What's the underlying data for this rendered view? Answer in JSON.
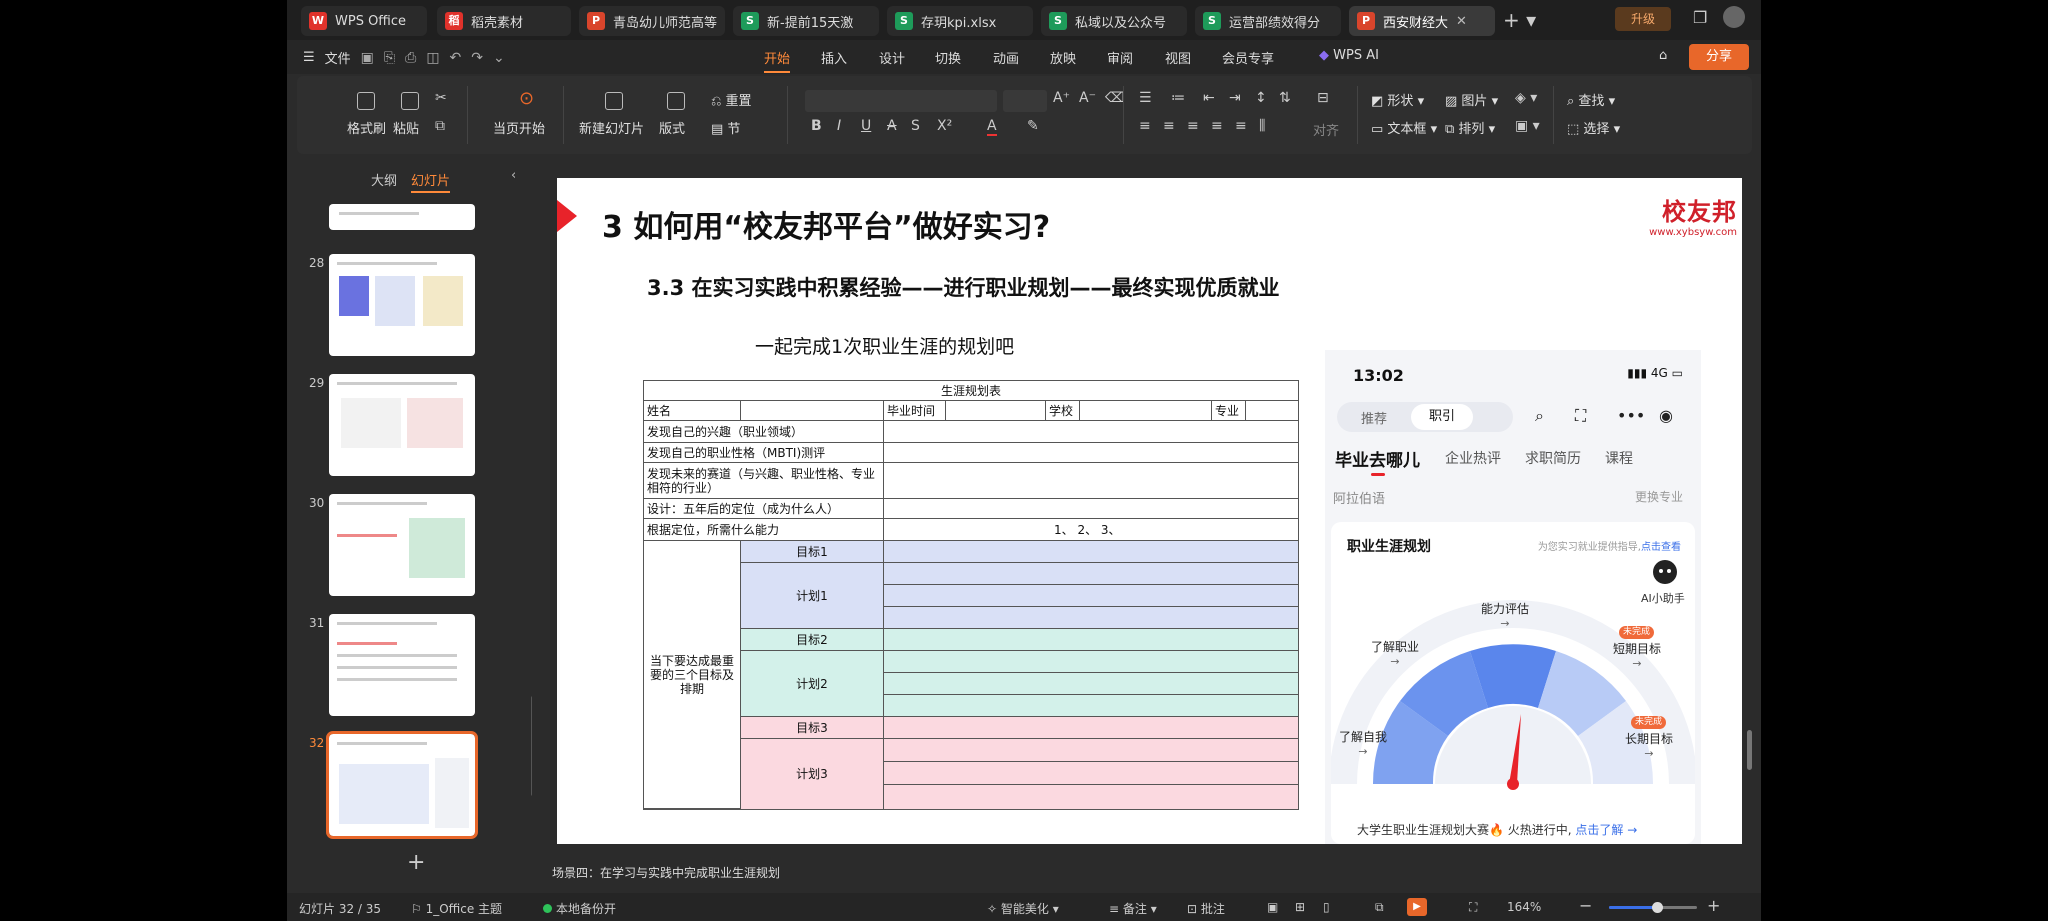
{
  "tabs": [
    {
      "label": "WPS Office",
      "icon": "W",
      "kind": "w",
      "active": false
    },
    {
      "label": "稻壳素材",
      "icon": "稻",
      "kind": "d",
      "active": false
    },
    {
      "label": "青岛幼儿师范高等",
      "icon": "P",
      "kind": "p",
      "active": false
    },
    {
      "label": "新-提前15天激",
      "icon": "S",
      "kind": "s",
      "active": false
    },
    {
      "label": "存玥kpi.xlsx",
      "icon": "S",
      "kind": "s",
      "active": false
    },
    {
      "label": "私域以及公众号",
      "icon": "S",
      "kind": "s",
      "active": false
    },
    {
      "label": "运营部绩效得分",
      "icon": "S",
      "kind": "s",
      "active": false
    },
    {
      "label": "西安财经大",
      "icon": "P",
      "kind": "p",
      "active": true
    }
  ],
  "titlebar": {
    "upgrade": "升级"
  },
  "menu": {
    "file": "文件",
    "items": [
      "开始",
      "插入",
      "设计",
      "切换",
      "动画",
      "放映",
      "审阅",
      "视图",
      "会员专享",
      "WPS AI"
    ],
    "active": "开始",
    "share": "分享"
  },
  "ribbon": {
    "format_painter": "格式刷",
    "paste": "粘贴",
    "from_current": "当页开始",
    "new_slide": "新建幻灯片",
    "layout": "版式",
    "reset": "重置",
    "section": "节",
    "align": "对齐",
    "shape": "形状",
    "picture": "图片",
    "find": "查找",
    "textbox": "文本框",
    "arrange": "排列",
    "select": "选择"
  },
  "left_panel": {
    "outline_tab": "大纲",
    "slides_tab": "幻灯片",
    "thumbnails": [
      {
        "num": "28"
      },
      {
        "num": "29"
      },
      {
        "num": "30"
      },
      {
        "num": "31"
      },
      {
        "num": "32"
      }
    ]
  },
  "slide": {
    "title": "3 如何用“校友邦平台”做好实习?",
    "brand_name": "校友邦",
    "brand_url": "www.xybsyw.com",
    "subtitle": "3.3  在实习实践中积累经验——进行职业规划——最终实现优质就业",
    "subtitle2": "一起完成1次职业生涯的规划吧",
    "planner": {
      "title": "生涯规划表",
      "name_label": "姓名",
      "grad_label": "毕业时间",
      "school_label": "学校",
      "major_label": "专业",
      "rows": [
        "发现自己的兴趣（职业领域）",
        "发现自己的职业性格（MBTI)测评",
        "发现未来的赛道（与兴趣、职业性格、专业相符的行业）",
        "设计：五年后的定位（成为什么人）",
        "根据定位，所需什么能力"
      ],
      "ability_items": "1、 2、 3、",
      "goals_label": "当下要达成最重要的三个目标及排期",
      "goal1": "目标1",
      "plan1": "计划1",
      "goal2": "目标2",
      "plan2": "计划2",
      "goal3": "目标3",
      "plan3": "计划3",
      "colors": {
        "g1": "#d9e0f6",
        "g2": "#d3f1ea",
        "g3": "#fbd9e0"
      }
    },
    "phone": {
      "time": "13:02",
      "network": "4G",
      "seg_recommend": "推荐",
      "seg_guide": "职引",
      "nav": [
        "毕业去哪儿",
        "企业热评",
        "求职简历",
        "课程"
      ],
      "major": "阿拉伯语",
      "switch_major": "更换专业",
      "card_title": "职业生涯规划",
      "card_hint": "为您实习就业提供指导,",
      "card_hint_link": "点击查看",
      "ai_helper": "AI小助手",
      "labels": {
        "ability": "能力评估",
        "know_career": "了解职业",
        "short_goal": "短期目标",
        "know_self": "了解自我",
        "long_goal": "长期目标",
        "incomplete": "未完成"
      },
      "banner": "大学生职业生涯规划大赛🔥 火热进行中,",
      "banner_link": "点击了解 →"
    }
  },
  "notes": "场景四：在学习与实践中完成职业生涯规划",
  "statusbar": {
    "slide_counter": "幻灯片 32 / 35",
    "theme": "1_Office 主题",
    "backup": "本地备份开",
    "beautify": "智能美化",
    "notes": "备注",
    "comments": "批注",
    "zoom": "164%",
    "zoom_fraction": 0.55
  }
}
